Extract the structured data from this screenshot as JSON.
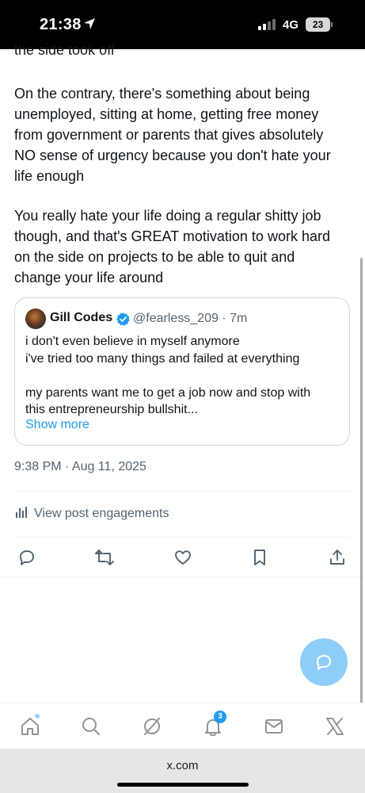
{
  "status_bar": {
    "time": "21:38",
    "network": "4G",
    "battery": "23"
  },
  "tweet": {
    "clipped_line": "the side took off",
    "paragraph_1": "On the contrary, there's something about being\nunemployed, sitting at home, getting free money\nfrom government or parents that gives absolutely\nNO sense of urgency because you don't hate your\nlife enough",
    "paragraph_2": "You really hate your life doing a regular shitty job\nthough, and that's GREAT motivation to work hard\non the side on projects to be able to quit and\nchange your life around",
    "timestamp": "9:38 PM · Aug 11, 2025",
    "engagements_label": "View post engagements"
  },
  "quote": {
    "name": "Gill Codes",
    "handle": "@fearless_209 · 7m",
    "text": "i don't even believe in myself anymore\ni've tried too many things and failed at everything\n\nmy parents want me to get a job now and stop with\nthis entrepreneurship bullshit...",
    "show_more": "Show more"
  },
  "actions": [
    "reply-icon",
    "repost-icon",
    "like-icon",
    "bookmark-icon",
    "share-icon"
  ],
  "bottom_nav": {
    "items": [
      "home-icon",
      "search-icon",
      "grok-icon",
      "notifications-icon",
      "messages-icon",
      "x-logo-icon"
    ],
    "notification_count": "3"
  },
  "browser": {
    "url": "x.com"
  },
  "colors": {
    "accent": "#1d9bf0",
    "secondary_text": "#536471",
    "border": "#cfd9de",
    "fab": "#8ecdf7"
  }
}
